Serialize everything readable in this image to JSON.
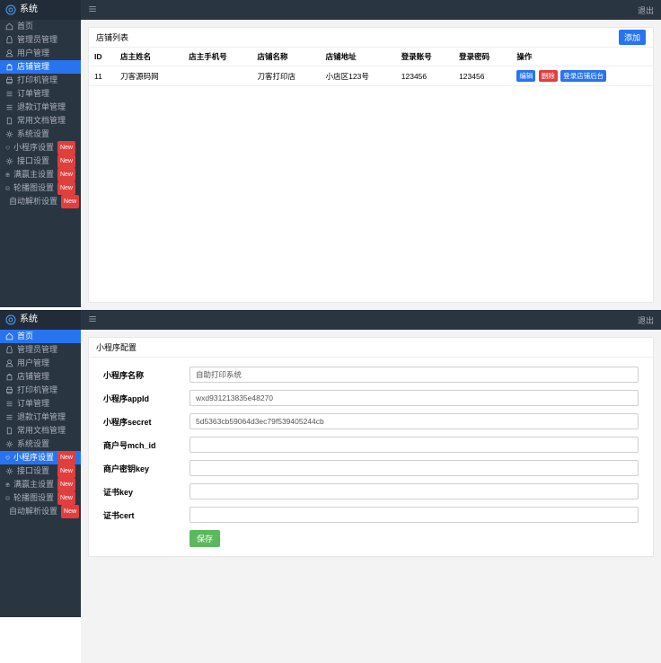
{
  "brand": "系统",
  "logout": "退出",
  "menu1": [
    {
      "label": "首页",
      "icon": "home"
    },
    {
      "label": "管理员管理",
      "icon": "lock"
    },
    {
      "label": "用户管理",
      "icon": "user"
    },
    {
      "label": "店铺管理",
      "icon": "bag",
      "active": true
    },
    {
      "label": "打印机管理",
      "icon": "print"
    },
    {
      "label": "订单管理",
      "icon": "list"
    },
    {
      "label": "退款订单管理",
      "icon": "list"
    },
    {
      "label": "常用文档管理",
      "icon": "doc"
    },
    {
      "label": "系统设置",
      "icon": "gear"
    },
    {
      "label": "小程序设置",
      "icon": "heart",
      "new": true
    },
    {
      "label": "接口设置",
      "icon": "gear",
      "new": true
    },
    {
      "label": "满赢主设置",
      "icon": "gift",
      "new": true
    },
    {
      "label": "轮播图设置",
      "icon": "img",
      "new": true
    },
    {
      "label": "自动解析设置",
      "icon": "print",
      "new": true
    }
  ],
  "panel1": {
    "title": "店铺列表",
    "add": "添加",
    "columns": [
      "ID",
      "店主姓名",
      "店主手机号",
      "店铺名称",
      "店铺地址",
      "登录账号",
      "登录密码",
      "操作"
    ],
    "row": {
      "id": "11",
      "name": "刀客源码网",
      "phone": "",
      "shop": "刀客打印店",
      "addr": "小店区123号",
      "acct": "123456",
      "pwd": "123456"
    },
    "ops": [
      "编辑",
      "删除",
      "登录店铺后台"
    ]
  },
  "menu2": [
    {
      "label": "首页",
      "icon": "home",
      "active": true
    },
    {
      "label": "管理员管理",
      "icon": "lock"
    },
    {
      "label": "用户管理",
      "icon": "user"
    },
    {
      "label": "店铺管理",
      "icon": "bag"
    },
    {
      "label": "打印机管理",
      "icon": "print"
    },
    {
      "label": "订单管理",
      "icon": "list"
    },
    {
      "label": "退款订单管理",
      "icon": "list"
    },
    {
      "label": "常用文档管理",
      "icon": "doc"
    },
    {
      "label": "系统设置",
      "icon": "gear"
    },
    {
      "label": "小程序设置",
      "icon": "heart",
      "active2": true,
      "new": true
    },
    {
      "label": "接口设置",
      "icon": "gear",
      "new": true
    },
    {
      "label": "满赢主设置",
      "icon": "gift",
      "new": true
    },
    {
      "label": "轮播图设置",
      "icon": "img",
      "new": true
    },
    {
      "label": "自动解析设置",
      "icon": "print",
      "new": true
    }
  ],
  "panel2": {
    "title": "小程序配置",
    "fields": [
      {
        "label": "小程序名称",
        "value": "自助打印系统"
      },
      {
        "label": "小程序appId",
        "value": "wxd931213835e48270"
      },
      {
        "label": "小程序secret",
        "value": "5d5363cb59064d3ec79f539405244cb"
      },
      {
        "label": "商户号mch_id",
        "value": ""
      },
      {
        "label": "商户密钥key",
        "value": ""
      },
      {
        "label": "证书key",
        "value": ""
      },
      {
        "label": "证书cert",
        "value": ""
      }
    ],
    "save": "保存"
  },
  "newBadge": "New"
}
